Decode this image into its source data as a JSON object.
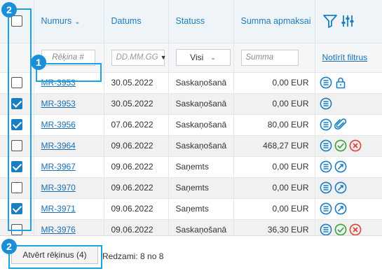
{
  "table": {
    "headers": {
      "number": "Numurs",
      "date": "Datums",
      "status": "Statuss",
      "amount": "Summa apmaksai"
    },
    "filters": {
      "number_placeholder": "Rēķina #",
      "date_placeholder": "DD.MM.GG",
      "status_value": "Visi",
      "amount_placeholder": "Summa",
      "clear_label": "Notīrīt filtrus"
    },
    "rows": [
      {
        "checked": false,
        "number": "MR-3953",
        "date": "30.05.2022",
        "status": "Saskaņošanā",
        "amount": "0,00 EUR",
        "actions": [
          "list-icon",
          "lock-icon"
        ]
      },
      {
        "checked": true,
        "number": "MR-3953",
        "date": "30.05.2022",
        "status": "Saskaņošanā",
        "amount": "0,00 EUR",
        "actions": [
          "list-icon"
        ]
      },
      {
        "checked": true,
        "number": "MR-3956",
        "date": "07.06.2022",
        "status": "Saskaņošanā",
        "amount": "80,00 EUR",
        "actions": [
          "list-icon",
          "paperclip-icon"
        ]
      },
      {
        "checked": false,
        "number": "MR-3964",
        "date": "09.06.2022",
        "status": "Saskaņošanā",
        "amount": "468,27 EUR",
        "actions": [
          "list-icon",
          "approve-icon",
          "reject-icon"
        ]
      },
      {
        "checked": true,
        "number": "MR-3967",
        "date": "09.06.2022",
        "status": "Saņemts",
        "amount": "0,00 EUR",
        "actions": [
          "list-icon",
          "forward-icon"
        ]
      },
      {
        "checked": false,
        "number": "MR-3970",
        "date": "09.06.2022",
        "status": "Saņemts",
        "amount": "0,00 EUR",
        "actions": [
          "list-icon",
          "forward-icon"
        ]
      },
      {
        "checked": true,
        "number": "MR-3971",
        "date": "09.06.2022",
        "status": "Saņemts",
        "amount": "0,00 EUR",
        "actions": [
          "list-icon",
          "forward-icon"
        ]
      },
      {
        "checked": false,
        "number": "MR-3976",
        "date": "09.06.2022",
        "status": "Saskaņošanā",
        "amount": "36,30 EUR",
        "actions": [
          "list-icon",
          "approve-icon",
          "reject-icon"
        ]
      }
    ]
  },
  "footer": {
    "open_button": "Atvērt rēķinus (4)",
    "count": "Redzami: 8 no 8"
  },
  "annotations": {
    "badge_checkbox_column": "2",
    "badge_number_cell": "1",
    "badge_open_button": "2"
  },
  "colors": {
    "accent": "#1a7fc1",
    "highlight": "#1aa3e0",
    "approve": "#3aa23a",
    "reject": "#d9443a"
  }
}
